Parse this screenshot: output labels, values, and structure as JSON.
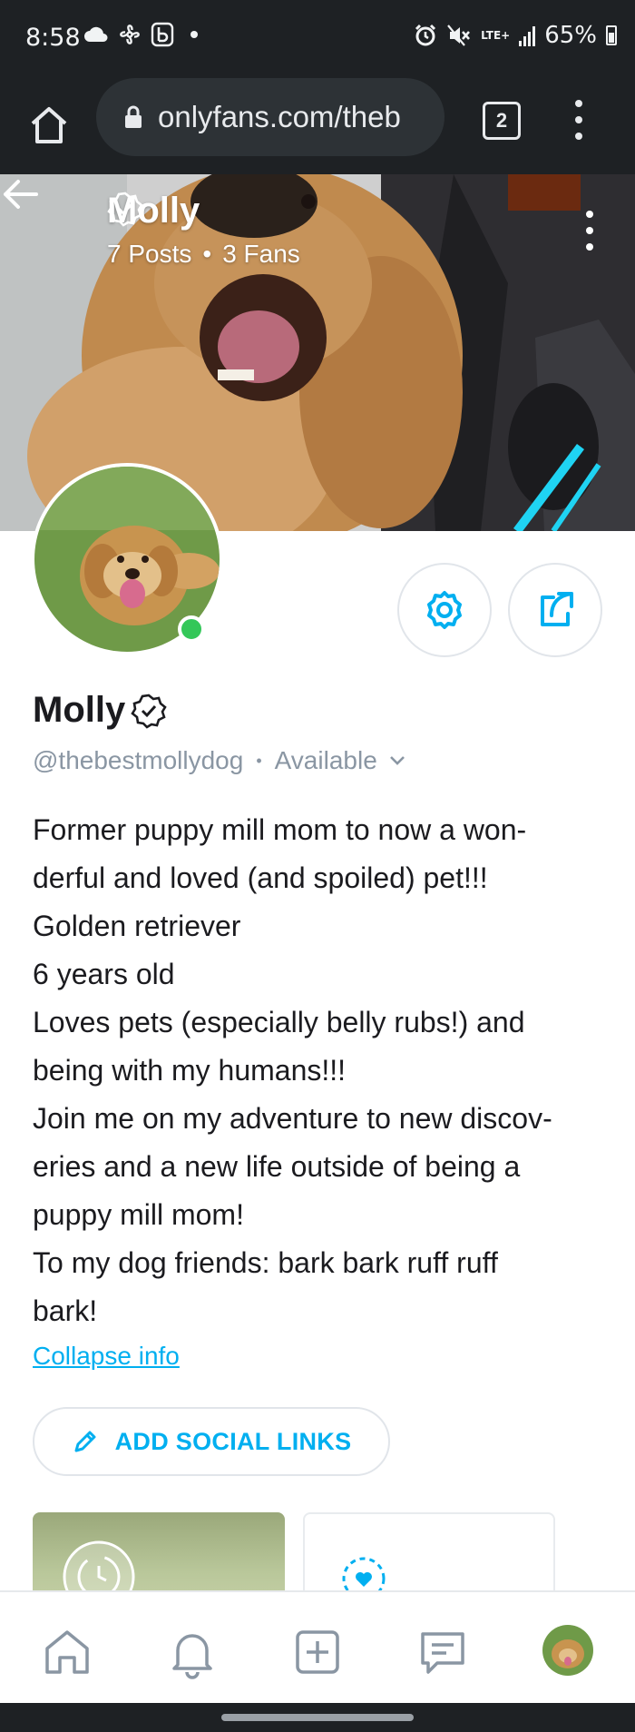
{
  "status_bar": {
    "time": "8:58",
    "network": "LTE+",
    "battery": "65%",
    "icons": [
      "cloud-icon",
      "fan-icon",
      "bluetooth-b-icon",
      "dot-icon",
      "alarm-icon",
      "mute-icon",
      "signal-icon",
      "battery-icon"
    ]
  },
  "browser": {
    "url": "onlyfans.com/theb",
    "tab_count": "2"
  },
  "cover": {
    "name": "Molly",
    "posts": "7 Posts",
    "separator": "•",
    "fans": "3 Fans"
  },
  "profile": {
    "name": "Molly",
    "handle": "@thebestmollydog",
    "separator": "•",
    "availability": "Available",
    "online": true,
    "bio_lines": [
      "Former puppy mill mom to now a won-",
      "derful and loved (and spoiled) pet!!!",
      "Golden retriever",
      "6 years old",
      "Loves pets (especially belly rubs!) and",
      "being with my humans!!!",
      "Join me on my adventure to new discov-",
      "eries and a new life outside of being a",
      "puppy mill mom!",
      "To my dog friends: bark bark ruff ruff",
      "bark!"
    ],
    "collapse_label": "Collapse info",
    "social_button_label": "ADD SOCIAL LINKS"
  },
  "colors": {
    "accent": "#00aff0",
    "online": "#34c759",
    "browser_bg": "#1e2124",
    "muted_text": "#8a96a3"
  },
  "bottom_nav": {
    "items": [
      "home-icon",
      "bell-icon",
      "add-post-icon",
      "messages-icon",
      "profile-avatar"
    ]
  }
}
